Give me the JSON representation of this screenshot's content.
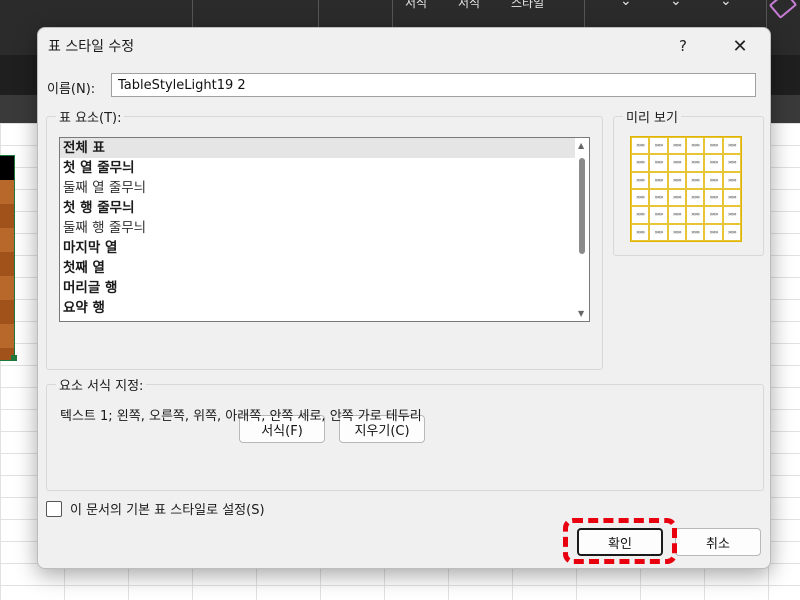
{
  "background": {
    "ribbon_labels": [
      "서식",
      "서식",
      "스타일"
    ]
  },
  "dialog": {
    "title": "표 스타일 수정",
    "help_label": "?",
    "close_label": "✕",
    "name_label": "이름(N):",
    "name_value": "TableStyleLight19 2",
    "elements_legend": "표 요소(T):",
    "elements": [
      {
        "label": "전체 표",
        "bold": true,
        "selected": true
      },
      {
        "label": "첫 열 줄무늬",
        "bold": true,
        "selected": false
      },
      {
        "label": "둘째 열 줄무늬",
        "bold": false,
        "selected": false
      },
      {
        "label": "첫 행 줄무늬",
        "bold": true,
        "selected": false
      },
      {
        "label": "둘째 행 줄무늬",
        "bold": false,
        "selected": false
      },
      {
        "label": "마지막 열",
        "bold": true,
        "selected": false
      },
      {
        "label": "첫째 열",
        "bold": true,
        "selected": false
      },
      {
        "label": "머리글 행",
        "bold": true,
        "selected": false
      },
      {
        "label": "요약 행",
        "bold": true,
        "selected": false
      }
    ],
    "format_button": "서식(F)",
    "clear_button": "지우기(C)",
    "preview_legend": "미리 보기",
    "preview_cell_text": "»»»",
    "format_legend": "요소 서식 지정:",
    "format_description": "텍스트 1; 왼쪽, 오른쪽, 위쪽, 아래쪽, 안쪽 세로, 안쪽 가로 테두리",
    "default_checkbox_label": "이 문서의 기본 표 스타일로 설정(S)",
    "ok_button": "확인",
    "cancel_button": "취소"
  },
  "colors": {
    "highlight": "#e8000f",
    "preview_border": "#e0b400",
    "sheet_selection": "#1e7a3c"
  }
}
